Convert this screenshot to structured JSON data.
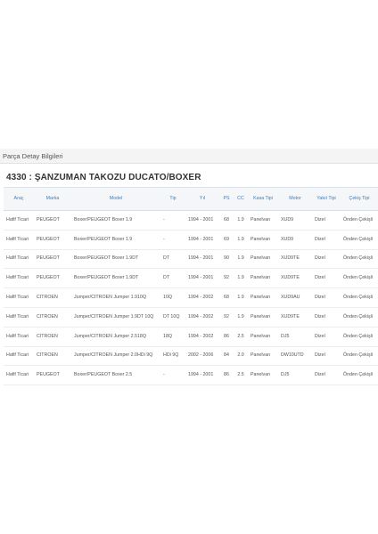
{
  "section": {
    "title": "Parça Detay Bilgileri"
  },
  "part": {
    "title": "4330 : ŞANZUMAN TAKOZU DUCATO/BOXER"
  },
  "table": {
    "headers": {
      "arac": "Araç",
      "marka": "Marka",
      "model": "Model",
      "tip": "Tip",
      "yil": "Yıl",
      "ps": "PS",
      "cc": "CC",
      "kasa": "Kasa Tipi",
      "motor": "Motor",
      "yakit": "Yakıt Tipi",
      "cekis": "Çekiş Tipi"
    },
    "rows": [
      {
        "arac": "Hafif Ticari",
        "marka": "PEUGEOT",
        "model": "Boxer/PEUGEOT Boxer 1.9",
        "tip": "-",
        "yil": "1994 - 2001",
        "ps": "68",
        "cc": "1.9",
        "kasa": "Panelvan",
        "motor": "XUD9",
        "yakit": "Dizel",
        "cekis": "Önden Çekişli"
      },
      {
        "arac": "Hafif Ticari",
        "marka": "PEUGEOT",
        "model": "Boxer/PEUGEOT Boxer 1.9",
        "tip": "-",
        "yil": "1994 - 2001",
        "ps": "69",
        "cc": "1.9",
        "kasa": "Panelvan",
        "motor": "XUD9",
        "yakit": "Dizel",
        "cekis": "Önden Çekişli"
      },
      {
        "arac": "Hafif Ticari",
        "marka": "PEUGEOT",
        "model": "Boxer/PEUGEOT Boxer 1.9DT",
        "tip": "DT",
        "yil": "1994 - 2001",
        "ps": "90",
        "cc": "1.9",
        "kasa": "Panelvan",
        "motor": "XUD9TE",
        "yakit": "Dizel",
        "cekis": "Önden Çekişli"
      },
      {
        "arac": "Hafif Ticari",
        "marka": "PEUGEOT",
        "model": "Boxer/PEUGEOT Boxer 1.9DT",
        "tip": "DT",
        "yil": "1994 - 2001",
        "ps": "92",
        "cc": "1.9",
        "kasa": "Panelvan",
        "motor": "XUD9TE",
        "yakit": "Dizel",
        "cekis": "Önden Çekişli"
      },
      {
        "arac": "Hafif Ticari",
        "marka": "CITROEN",
        "model": "Jumper/CITROEN Jumper 1.910Q",
        "tip": "10Q",
        "yil": "1994 - 2002",
        "ps": "68",
        "cc": "1.9",
        "kasa": "Panelvan",
        "motor": "XUD9AU",
        "yakit": "Dizel",
        "cekis": "Önden Çekişli"
      },
      {
        "arac": "Hafif Ticari",
        "marka": "CITROEN",
        "model": "Jumper/CITROEN Jumper 1.9DT 10Q",
        "tip": "DT 10Q",
        "yil": "1994 - 2002",
        "ps": "92",
        "cc": "1.9",
        "kasa": "Panelvan",
        "motor": "XUD9TE",
        "yakit": "Dizel",
        "cekis": "Önden Çekişli"
      },
      {
        "arac": "Hafif Ticari",
        "marka": "CITROEN",
        "model": "Jumper/CITROEN Jumper 2.518Q",
        "tip": "18Q",
        "yil": "1994 - 2002",
        "ps": "86",
        "cc": "2.5",
        "kasa": "Panelvan",
        "motor": "DJ5",
        "yakit": "Dizel",
        "cekis": "Önden Çekişli"
      },
      {
        "arac": "Hafif Ticari",
        "marka": "CITROEN",
        "model": "Jumper/CITROEN Jumper 2.0HDi 9Q",
        "tip": "HDi 9Q",
        "yil": "2002 - 2006",
        "ps": "84",
        "cc": "2.0",
        "kasa": "Panelvan",
        "motor": "DW10UTD",
        "yakit": "Dizel",
        "cekis": "Önden Çekişli"
      },
      {
        "arac": "Hafif Ticari",
        "marka": "PEUGEOT",
        "model": "Boxer/PEUGEOT Boxer 2.5",
        "tip": "-",
        "yil": "1994 - 2001",
        "ps": "86",
        "cc": "2.5",
        "kasa": "Panelvan",
        "motor": "DJ5",
        "yakit": "Dizel",
        "cekis": "Önden Çekişli"
      }
    ]
  }
}
